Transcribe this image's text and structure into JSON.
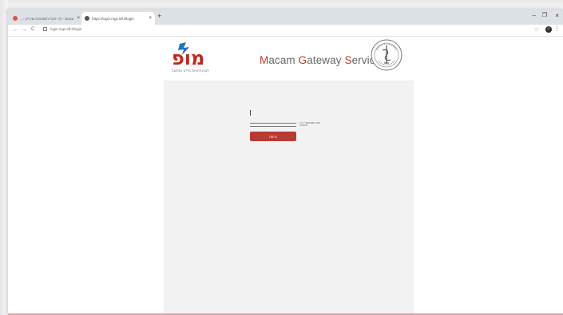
{
  "browser": {
    "tabs": [
      {
        "title": "...- טוטוס - לכ יהנלו המוצהות שיוריון",
        "active": false,
        "favicon_color": "#d9534f"
      },
      {
        "title": "https://login.mgs.idf.il/login",
        "active": true,
        "favicon_color": "#555555"
      }
    ],
    "new_tab_label": "+",
    "window_controls": {
      "minimize": "–",
      "maximize": "❐",
      "close": "×"
    },
    "url": "login.mgs.idf.il/login",
    "nav": {
      "back": "←",
      "forward": "→",
      "reload": "C"
    },
    "star": "☆",
    "menu": "⋮"
  },
  "header": {
    "logo_text": "מופ",
    "logo_subtitle": "לטכנולוגיות מידע ומחשב",
    "brand_letters": [
      {
        "text": "M",
        "accent": true
      },
      {
        "text": "acam ",
        "accent": false
      },
      {
        "text": "G",
        "accent": true
      },
      {
        "text": "ateway ",
        "accent": false
      },
      {
        "text": "S",
        "accent": true
      },
      {
        "text": "ervices",
        "accent": false
      }
    ],
    "accent_color": "#c0392b"
  },
  "form": {
    "username_label": "שם משתמש / ת.ז",
    "username_value": "",
    "password_label": "סיסמה",
    "password_value": "",
    "login_button": "כניסה",
    "button_color": "#b83b33"
  }
}
